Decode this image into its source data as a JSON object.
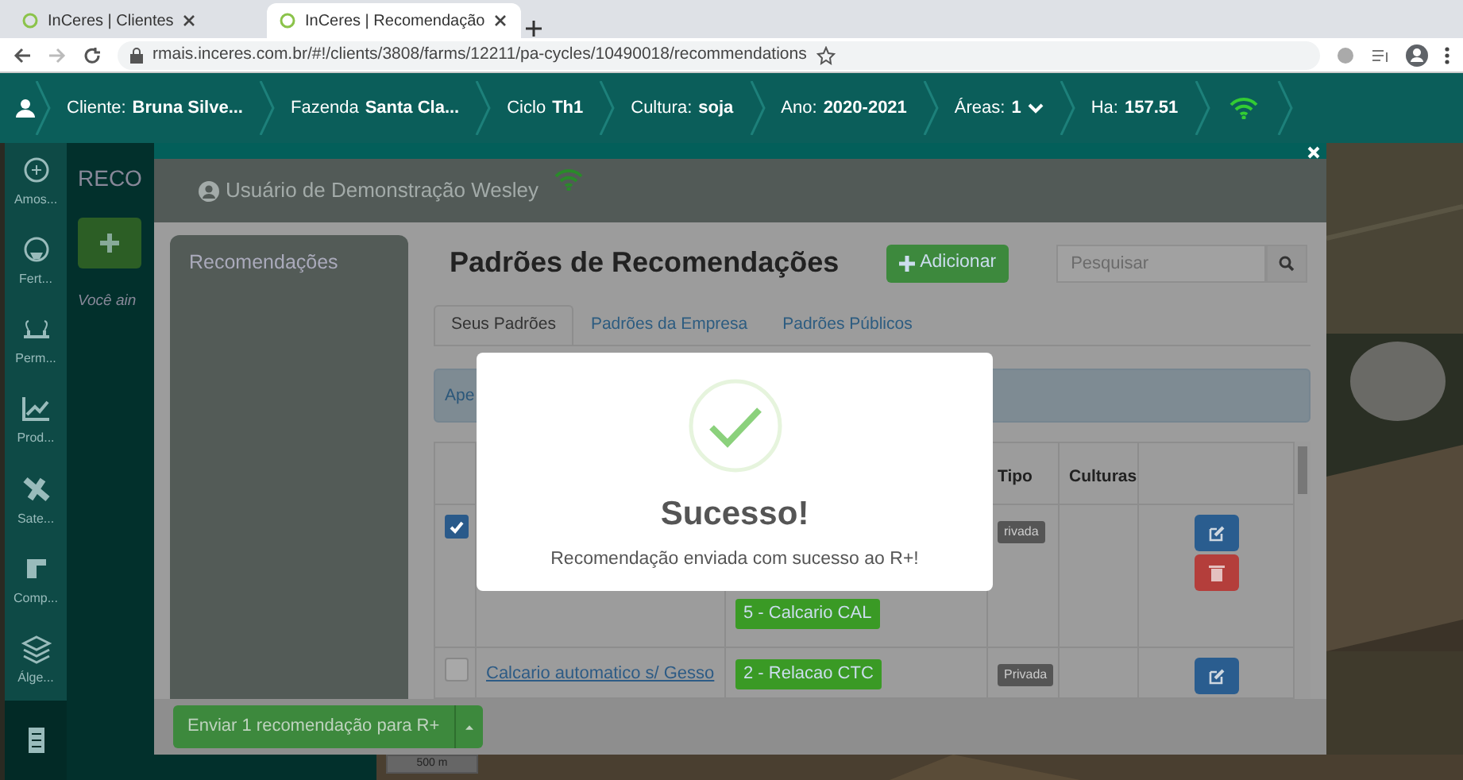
{
  "browser": {
    "tabs": [
      {
        "title": "InCeres | Clientes",
        "selected": false
      },
      {
        "title": "InCeres | Recomendação",
        "selected": true
      }
    ],
    "url": "rmais.inceres.com.br/#!/clients/3808/farms/12211/pa-cycles/10490018/recommendations"
  },
  "navbar": {
    "items": [
      {
        "label": "Cliente:",
        "value": "Bruna Silve..."
      },
      {
        "label": "Fazenda",
        "value": "Santa Cla..."
      },
      {
        "label": "Ciclo",
        "value": "Th1"
      },
      {
        "label": "Cultura:",
        "value": "soja"
      },
      {
        "label": "Ano:",
        "value": "2020-2021"
      },
      {
        "label": "Áreas:",
        "value": "1",
        "kind": "dropdown"
      },
      {
        "label": "Ha:",
        "value": "157.51"
      }
    ]
  },
  "sidebar": {
    "items": [
      {
        "label": "Amos...",
        "selected": false
      },
      {
        "label": "Fert...",
        "selected": false
      },
      {
        "label": "Perm...",
        "selected": false
      },
      {
        "label": "Prod...",
        "selected": false
      },
      {
        "label": "Sate...",
        "selected": false
      },
      {
        "label": "Comp...",
        "selected": false
      },
      {
        "label": "Álge...",
        "selected": false
      },
      {
        "selected": true
      }
    ]
  },
  "panel": {
    "title": "RECO",
    "empty_message": "Você ain"
  },
  "map_scale": "500 m",
  "dialog": {
    "user": "Usuário de Demonstração Wesley",
    "menu_title": "Recomendações",
    "title": "Padrões de Recomendações",
    "add_button": "Adicionar",
    "search": {
      "placeholder": "Pesquisar"
    },
    "tabs": [
      {
        "label": "Seus Padrões",
        "selected": true
      },
      {
        "label": "Padrões da Empresa",
        "selected": false
      },
      {
        "label": "Padrões Públicos",
        "selected": false
      }
    ],
    "alert": "Ape",
    "table": {
      "columns": [
        "Tipo",
        "Culturas"
      ],
      "rows": [
        {
          "checked": true,
          "tags": [
            "5 - Calcario CAL"
          ],
          "type": "rivada"
        },
        {
          "checked": false,
          "name": "Calcario automatico s/ Gesso",
          "tags": [
            "2 - Relacao CTC"
          ],
          "type": "Privada"
        }
      ]
    },
    "send_button": "Enviar 1 recomendação para R+"
  },
  "alert_modal": {
    "title": "Sucesso!",
    "message": "Recomendação enviada com sucesso ao R+!"
  }
}
